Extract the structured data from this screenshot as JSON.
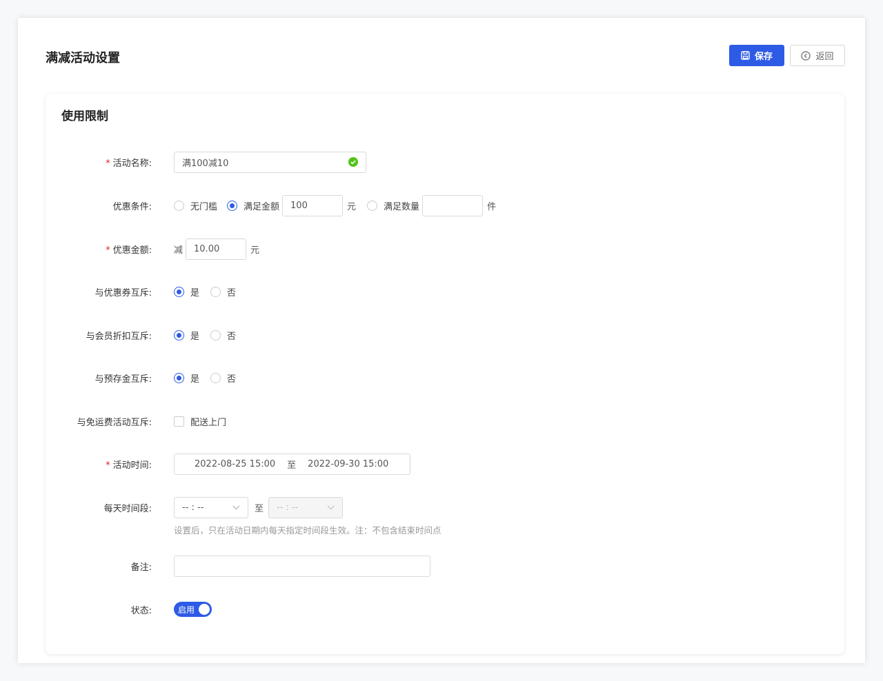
{
  "page": {
    "title": "满减活动设置"
  },
  "toolbar": {
    "save_label": "保存",
    "back_label": "返回"
  },
  "card": {
    "title": "使用限制"
  },
  "form": {
    "name": {
      "label": "活动名称:",
      "value": "满100减10",
      "required": true
    },
    "condition": {
      "label": "优惠条件:",
      "opt_none": "无门槛",
      "opt_amount": "满足金额",
      "amount_value": "100",
      "amount_unit": "元",
      "opt_qty": "满足数量",
      "qty_value": "",
      "qty_unit": "件"
    },
    "discount": {
      "label": "优惠金额:",
      "prefix": "减",
      "value": "10.00",
      "unit": "元",
      "required": true
    },
    "coupon_exclusive": {
      "label": "与优惠券互斥:",
      "yes": "是",
      "no": "否"
    },
    "member_exclusive": {
      "label": "与会员折扣互斥:",
      "yes": "是",
      "no": "否"
    },
    "deposit_exclusive": {
      "label": "与预存金互斥:",
      "yes": "是",
      "no": "否"
    },
    "freeship_exclusive": {
      "label": "与免运费活动互斥:",
      "option": "配送上门"
    },
    "period": {
      "label": "活动时间:",
      "start": "2022-08-25 15:00",
      "sep": "至",
      "end": "2022-09-30 15:00",
      "required": true
    },
    "daily": {
      "label": "每天时间段:",
      "start": "-- : --",
      "sep": "至",
      "end": "-- : --",
      "hint": "设置后，只在活动日期内每天指定时间段生效。注：不包含结束时间点"
    },
    "remark": {
      "label": "备注:",
      "value": ""
    },
    "status": {
      "label": "状态:",
      "toggle_label": "启用"
    }
  },
  "colors": {
    "primary": "#2e5be6",
    "required": "#e02020",
    "success": "#52c41a"
  }
}
